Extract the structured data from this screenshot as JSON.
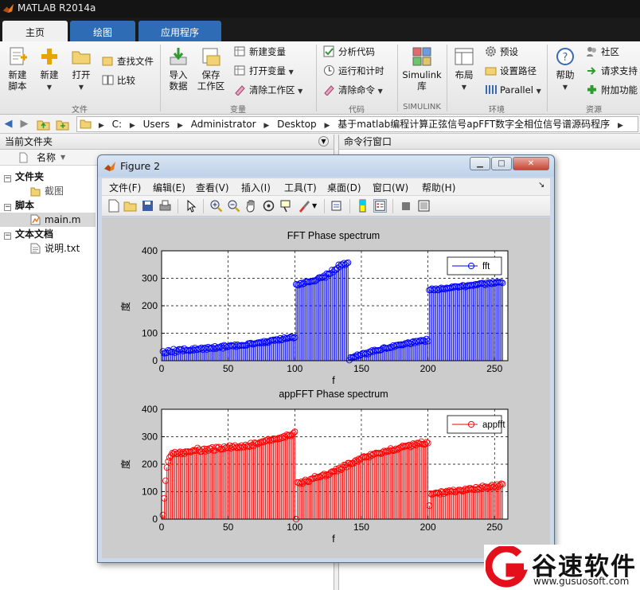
{
  "app": {
    "title": "MATLAB R2014a"
  },
  "tabs": [
    {
      "label": "主页",
      "active": true
    },
    {
      "label": "绘图",
      "active": false
    },
    {
      "label": "应用程序",
      "active": false
    }
  ],
  "ribbon": {
    "file": {
      "group_label": "文件",
      "new_script": "新建\n脚本",
      "new": "新建",
      "open": "打开",
      "find_files": "查找文件",
      "compare": "比较"
    },
    "variable": {
      "group_label": "变量",
      "import_data": "导入\n数据",
      "save_workspace": "保存\n工作区",
      "new_variable": "新建变量",
      "open_variable": "打开变量",
      "clear_workspace": "清除工作区"
    },
    "code": {
      "group_label": "代码",
      "analyze_code": "分析代码",
      "run_and_time": "运行和计时",
      "clear_commands": "清除命令"
    },
    "simulink": {
      "group_label": "SIMULINK",
      "library": "Simulink\n库"
    },
    "environment": {
      "group_label": "环境",
      "layout": "布局",
      "preferences": "预设",
      "set_path": "设置路径",
      "parallel": "Parallel"
    },
    "resources": {
      "group_label": "资源",
      "help": "帮助",
      "community": "社区",
      "request_support": "请求支持",
      "add_ons": "附加功能"
    }
  },
  "address": {
    "segments": [
      "C:",
      "Users",
      "Administrator",
      "Desktop",
      "基于matlab编程计算正弦信号apFFT数字全相位信号谱源码程序"
    ]
  },
  "current_folder": {
    "title": "当前文件夹",
    "name_col": "名称",
    "tree": [
      {
        "label": "文件夹",
        "kind": "group",
        "selected": false
      },
      {
        "label": "截图",
        "kind": "folder",
        "selected": false
      },
      {
        "label": "脚本",
        "kind": "group",
        "selected": false
      },
      {
        "label": "main.m",
        "kind": "mfile",
        "selected": true
      },
      {
        "label": "文本文档",
        "kind": "group",
        "selected": false
      },
      {
        "label": "说明.txt",
        "kind": "txt",
        "selected": false
      }
    ]
  },
  "command_window": {
    "title": "命令行窗口"
  },
  "figure": {
    "title": "Figure 2",
    "menu": [
      "文件(F)",
      "编辑(E)",
      "查看(V)",
      "插入(I)",
      "工具(T)",
      "桌面(D)",
      "窗口(W)",
      "帮助(H)"
    ]
  },
  "chart_data": [
    {
      "type": "stem",
      "title": "FFT Phase spectrum",
      "xlabel": "f",
      "ylabel": "度",
      "xlim": [
        0,
        260
      ],
      "ylim": [
        0,
        400
      ],
      "xticks": [
        0,
        50,
        100,
        150,
        200,
        250
      ],
      "yticks": [
        0,
        100,
        200,
        300,
        400
      ],
      "grid": true,
      "legend_position": "top-right",
      "series": [
        {
          "name": "fft",
          "color": "#0000ff",
          "x_start": 1,
          "x_step": 1,
          "values": [
            34,
            27,
            28,
            29,
            38,
            35,
            31,
            32,
            42,
            29,
            37,
            33,
            41,
            41,
            41,
            35,
            44,
            37,
            39,
            38,
            36,
            38,
            43,
            38,
            46,
            40,
            40,
            43,
            43,
            47,
            40,
            45,
            47,
            41,
            49,
            44,
            45,
            48,
            43,
            52,
            44,
            48,
            48,
            50,
            53,
            45,
            56,
            53,
            49,
            52,
            53,
            56,
            54,
            53,
            58,
            51,
            58,
            54,
            55,
            56,
            56,
            55,
            56,
            56,
            62,
            63,
            64,
            60,
            60,
            62,
            63,
            65,
            66,
            64,
            68,
            65,
            71,
            65,
            70,
            66,
            71,
            74,
            74,
            76,
            73,
            77,
            77,
            74,
            81,
            75,
            78,
            84,
            80,
            82,
            81,
            84,
            87,
            86,
            82,
            84,
            278,
            276,
            275,
            281,
            283,
            279,
            281,
            288,
            287,
            288,
            286,
            288,
            289,
            291,
            289,
            293,
            297,
            302,
            303,
            302,
            303,
            309,
            303,
            317,
            315,
            316,
            318,
            330,
            323,
            331,
            331,
            337,
            349,
            343,
            350,
            349,
            355,
            349,
            354,
            357,
            2,
            12,
            11,
            12,
            16,
            14,
            22,
            19,
            19,
            23,
            27,
            27,
            24,
            28,
            24,
            32,
            31,
            37,
            33,
            39,
            36,
            37,
            38,
            38,
            40,
            45,
            48,
            46,
            44,
            46,
            46,
            50,
            48,
            55,
            51,
            56,
            56,
            58,
            57,
            59,
            57,
            59,
            63,
            62,
            66,
            64,
            61,
            67,
            70,
            65,
            71,
            71,
            68,
            73,
            74,
            72,
            74,
            69,
            79,
            71,
            257,
            258,
            262,
            258,
            257,
            262,
            258,
            257,
            262,
            265,
            261,
            263,
            260,
            265,
            264,
            264,
            265,
            269,
            266,
            270,
            270,
            269,
            267,
            270,
            270,
            274,
            273,
            268,
            271,
            274,
            272,
            275,
            275,
            273,
            277,
            278,
            276,
            279,
            281,
            281,
            283,
            279,
            276,
            283,
            279,
            285,
            282,
            280,
            286,
            281,
            285,
            286,
            285,
            286,
            285,
            283
          ]
        }
      ]
    },
    {
      "type": "stem",
      "title": "appFFT Phase spectrum",
      "xlabel": "f",
      "ylabel": "度",
      "xlim": [
        0,
        260
      ],
      "ylim": [
        0,
        400
      ],
      "xticks": [
        0,
        50,
        100,
        150,
        200,
        250
      ],
      "yticks": [
        0,
        100,
        200,
        300,
        400
      ],
      "grid": true,
      "legend_position": "top-right",
      "series": [
        {
          "name": "appfft",
          "color": "#ff0000",
          "x_start": 1,
          "x_step": 1,
          "values": [
            15,
            76,
            140,
            188,
            210,
            224,
            231,
            240,
            238,
            244,
            237,
            238,
            242,
            245,
            237,
            243,
            238,
            246,
            245,
            246,
            245,
            244,
            248,
            251,
            249,
            250,
            259,
            253,
            246,
            246,
            254,
            256,
            247,
            255,
            250,
            257,
            256,
            261,
            250,
            250,
            262,
            259,
            262,
            254,
            255,
            254,
            264,
            259,
            261,
            259,
            268,
            258,
            264,
            262,
            268,
            260,
            260,
            264,
            260,
            268,
            262,
            262,
            270,
            265,
            266,
            264,
            277,
            270,
            266,
            278,
            276,
            273,
            276,
            280,
            279,
            283,
            281,
            286,
            286,
            291,
            285,
            289,
            287,
            293,
            291,
            292,
            291,
            295,
            293,
            298,
            296,
            302,
            298,
            307,
            304,
            306,
            303,
            307,
            313,
            318,
            0,
            134,
            133,
            129,
            136,
            130,
            137,
            143,
            138,
            136,
            137,
            146,
            147,
            148,
            156,
            150,
            152,
            154,
            153,
            158,
            160,
            164,
            157,
            162,
            160,
            163,
            170,
            173,
            173,
            174,
            182,
            175,
            185,
            182,
            180,
            188,
            197,
            197,
            190,
            204,
            204,
            200,
            203,
            203,
            210,
            214,
            210,
            219,
            216,
            222,
            226,
            228,
            225,
            226,
            229,
            225,
            236,
            232,
            237,
            237,
            241,
            240,
            240,
            240,
            238,
            244,
            248,
            244,
            248,
            246,
            249,
            257,
            251,
            249,
            251,
            256,
            253,
            257,
            260,
            262,
            267,
            263,
            266,
            266,
            268,
            270,
            263,
            267,
            275,
            272,
            269,
            277,
            276,
            275,
            282,
            273,
            272,
            273,
            280,
            277,
            49,
            93,
            89,
            92,
            94,
            96,
            95,
            96,
            91,
            101,
            99,
            93,
            98,
            102,
            98,
            104,
            101,
            101,
            106,
            99,
            99,
            103,
            106,
            106,
            104,
            101,
            104,
            110,
            106,
            107,
            112,
            112,
            108,
            109,
            107,
            116,
            109,
            108,
            115,
            113,
            121,
            115,
            118,
            112,
            117,
            114,
            118,
            124,
            116,
            121,
            115,
            126,
            119,
            124,
            129,
            127
          ]
        }
      ]
    }
  ],
  "watermark": {
    "brand": "谷速软件",
    "url": "www.gusuosoft.com"
  }
}
